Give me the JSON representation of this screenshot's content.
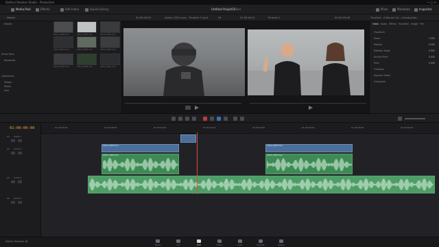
{
  "window": {
    "title": "DaVinci Resolve Studio - Production",
    "controls": "— ▢ ✕"
  },
  "topbar": {
    "items": [
      "Media Pool",
      "Effects",
      "Edit Index",
      "Sound Library"
    ],
    "center_title": "Untitled Project 1",
    "center_sub": "Edited",
    "right_items": [
      "Mixer",
      "Metadata",
      "Inspector"
    ]
  },
  "subbar": {
    "left": "Master",
    "source_tc": "00:00:00:00",
    "clip_name": "Adrian_0023.mov - Timeline 1.mp4",
    "fit": "Fit",
    "record_tc": "01:00:04:11",
    "timeline_name": "Timeline 1",
    "right_tc": "00:00:03:08",
    "inspector_title": "Timeline - A Dancer Inc - Introduction..."
  },
  "mediapool": {
    "bins": [
      "Master"
    ],
    "smart_bins": "Smart Bins",
    "keywords": "Keywords",
    "collections": "Collections",
    "people": [
      "People",
      "Shoes",
      "Hair"
    ],
    "thumbs": [
      {
        "label": "Adrian_0001.mov"
      },
      {
        "label": "Adrian_0007.mov"
      },
      {
        "label": "Adrian_0012.mov"
      },
      {
        "label": "Adrian_0014.mov"
      },
      {
        "label": "Adrian_0018.mov"
      },
      {
        "label": "Adrian_0023.mov"
      },
      {
        "label": "Adrian_0031.mov"
      },
      {
        "label": "Adrian_0033.mov"
      },
      {
        "label": "Adrian_0041.mov"
      }
    ],
    "thumb_colors": [
      "#4b4d50",
      "#bfc2c4",
      "#3a3b3e",
      "#2e2f33",
      "#5f6a60",
      "#3b3d40",
      "#3a3b3e",
      "#2f3f2f",
      "#2c2d30"
    ]
  },
  "inspector": {
    "tabs": [
      "Video",
      "Audio",
      "Effects",
      "Transition",
      "Image",
      "File"
    ],
    "rows": [
      {
        "label": "Transform",
        "value": ""
      },
      {
        "label": "Zoom",
        "value": "1.000"
      },
      {
        "label": "Position",
        "value": "0.000"
      },
      {
        "label": "Rotation Angle",
        "value": "0.000"
      },
      {
        "label": "Anchor Point",
        "value": "0.000"
      },
      {
        "label": "Pitch",
        "value": "0.000"
      },
      {
        "label": "Cropping",
        "value": ""
      },
      {
        "label": "Dynamic Zoom",
        "value": ""
      },
      {
        "label": "Composite",
        "value": ""
      }
    ]
  },
  "timeline": {
    "timecode": "01:00:00:00",
    "tracks": [
      {
        "name": "V1",
        "label": "Video 1"
      },
      {
        "name": "A1",
        "label": "Audio 1"
      },
      {
        "name": "A2",
        "label": "Audio 2"
      },
      {
        "name": "A3",
        "label": "Audio 3"
      }
    ],
    "clip_names": [
      "Adrian_0023.mov",
      "Adrian_0023.mov",
      "Adrian_0023.mov",
      "Adrian_0023.mov"
    ],
    "ruler_marks": [
      "01:00:00:00",
      "01:00:08:00",
      "01:00:16:00",
      "01:00:24:00",
      "01:00:32:00",
      "01:00:40:00",
      "01:00:48:00",
      "01:00:56:00"
    ]
  },
  "pages": [
    {
      "label": "Media",
      "icon": "media-icon"
    },
    {
      "label": "Cut",
      "icon": "cut-icon"
    },
    {
      "label": "Edit",
      "icon": "edit-icon"
    },
    {
      "label": "Fusion",
      "icon": "fusion-icon"
    },
    {
      "label": "Color",
      "icon": "color-icon"
    },
    {
      "label": "Fairlight",
      "icon": "fairlight-icon"
    },
    {
      "label": "Deliver",
      "icon": "deliver-icon"
    }
  ],
  "brand": "DaVinci Resolve 18",
  "colors": {
    "accent": "#e6a23c",
    "playhead": "#e04a3a",
    "audio": "#3e8a55",
    "video": "#4b6f9a"
  }
}
